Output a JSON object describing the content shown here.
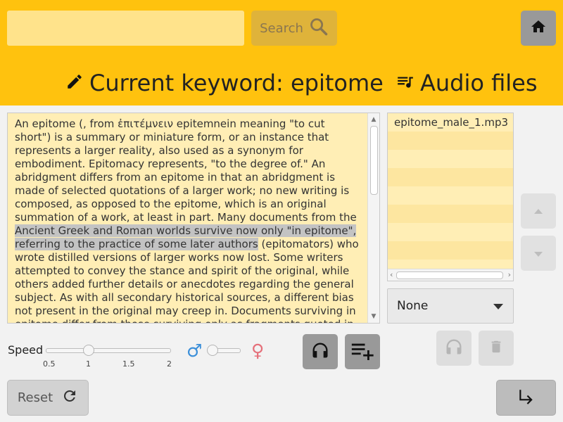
{
  "search": {
    "value": "",
    "placeholder": "",
    "button_label": "Search",
    "icon": "search-icon"
  },
  "header": {
    "keyword_prefix": "Current keyword: ",
    "keyword": "epitome",
    "keyword_icon": "pencil-icon",
    "audio_title": "Audio files",
    "audio_icon": "playlist-music-icon",
    "home_icon": "home-icon"
  },
  "text": {
    "before": "An epitome (, from ἐπιτέμνειν epitemnein meaning \"to cut short\") is a summary or miniature form, or an instance that represents a larger reality, also used as a synonym for embodiment. Epitomacy represents, \"to the degree of.\" An abridgment differs from an epitome in that an abridgment is made of selected quotations of a larger work; no new writing is composed, as opposed to the epitome, which is an original summation of a work, at least in part. Many documents from the ",
    "highlighted": "Ancient Greek and Roman worlds survive now only \"in epitome\", referring to the practice of some later authors",
    "after": " (epitomators) who wrote distilled versions of larger works now lost. Some writers attempted to convey the stance and spirit of the original, while others added further details or anecdotes regarding the general subject. As with all secondary historical sources, a different bias not present in the original may creep in. Documents surviving in epitome differ from those surviving only as fragments quoted in"
  },
  "audio_files": [
    "epitome_male_1.mp3",
    "",
    "",
    "",
    "",
    "",
    "",
    "",
    ""
  ],
  "controls": {
    "select_value": "None",
    "speed_label": "Speed",
    "speed_ticks": [
      "0.5",
      "1",
      "1.5",
      "2"
    ],
    "speed_value": 1,
    "gender_male_icon": "♂",
    "gender_female_icon": "♀",
    "voice_value": 0,
    "reset_label": "Reset"
  },
  "colors": {
    "header": "#ffc20e",
    "text_bg": "#ffeeb5",
    "highlight": "#c3c3c3",
    "male": "#3b8fd9",
    "female": "#e5707a"
  }
}
